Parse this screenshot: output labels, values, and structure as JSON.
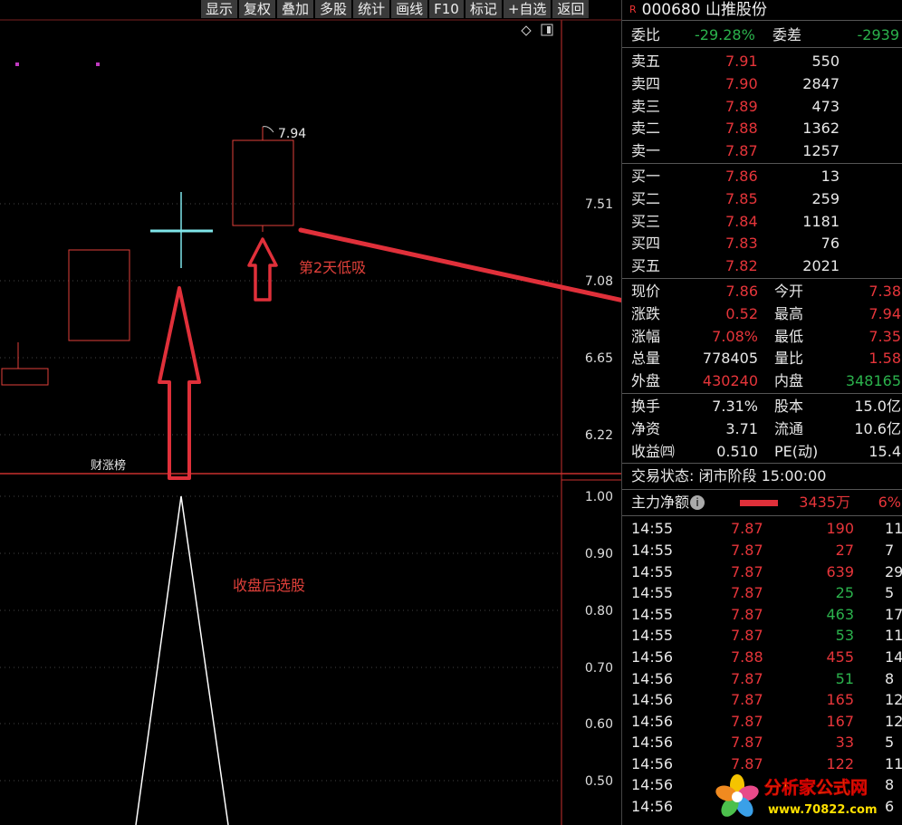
{
  "toolbar": [
    "显示",
    "复权",
    "叠加",
    "多股",
    "统计",
    "画线",
    "F10",
    "标记",
    "+自选",
    "返回"
  ],
  "chart": {
    "price_axis": [
      "7.51",
      "7.08",
      "6.65",
      "6.22"
    ],
    "indicator_axis": [
      "1.00",
      "0.90",
      "0.80",
      "0.70",
      "0.60",
      "0.50"
    ],
    "high_label": "7.94",
    "annotation_day2": "第2天低吸",
    "annotation_select": "收盘后选股",
    "badge": "财涨榜"
  },
  "panel": {
    "stock_code": "000680",
    "stock_name": "山推股份",
    "mark": "R",
    "weibi": {
      "label1": "委比",
      "val1": "-29.28%",
      "label2": "委差",
      "val2": "-2939"
    },
    "sell": [
      {
        "label": "卖五",
        "price": "7.91",
        "vol": "550"
      },
      {
        "label": "卖四",
        "price": "7.90",
        "vol": "2847"
      },
      {
        "label": "卖三",
        "price": "7.89",
        "vol": "473"
      },
      {
        "label": "卖二",
        "price": "7.88",
        "vol": "1362"
      },
      {
        "label": "卖一",
        "price": "7.87",
        "vol": "1257"
      }
    ],
    "buy": [
      {
        "label": "买一",
        "price": "7.86",
        "vol": "13"
      },
      {
        "label": "买二",
        "price": "7.85",
        "vol": "259"
      },
      {
        "label": "买三",
        "price": "7.84",
        "vol": "1181"
      },
      {
        "label": "买四",
        "price": "7.83",
        "vol": "76"
      },
      {
        "label": "买五",
        "price": "7.82",
        "vol": "2021"
      }
    ],
    "quote": [
      {
        "l1": "现价",
        "v1": "7.86",
        "l2": "今开",
        "v2": "7.38"
      },
      {
        "l1": "涨跌",
        "v1": "0.52",
        "l2": "最高",
        "v2": "7.94"
      },
      {
        "l1": "涨幅",
        "v1": "7.08%",
        "l2": "最低",
        "v2": "7.35"
      },
      {
        "l1": "总量",
        "v1": "778405",
        "l2": "量比",
        "v2": "1.58"
      },
      {
        "l1": "外盘",
        "v1": "430240",
        "l2": "内盘",
        "v2": "348165"
      }
    ],
    "stats": [
      {
        "l1": "换手",
        "v1": "7.31%",
        "l2": "股本",
        "v2": "15.0亿"
      },
      {
        "l1": "净资",
        "v1": "3.71",
        "l2": "流通",
        "v2": "10.6亿"
      },
      {
        "l1": "收益㈣",
        "v1": "0.510",
        "l2": "PE(动)",
        "v2": "15.4"
      }
    ],
    "trade_status": "交易状态: 闭市阶段 15:00:00",
    "main_force": {
      "label": "主力净额",
      "value": "3435万",
      "pct": "6%"
    },
    "ticks": [
      {
        "t": "14:55",
        "p": "7.87",
        "v": "190",
        "n": "11",
        "c": "red"
      },
      {
        "t": "14:55",
        "p": "7.87",
        "v": "27",
        "n": "7",
        "c": "red"
      },
      {
        "t": "14:55",
        "p": "7.87",
        "v": "639",
        "n": "29",
        "c": "red"
      },
      {
        "t": "14:55",
        "p": "7.87",
        "v": "25",
        "n": "5",
        "c": "green"
      },
      {
        "t": "14:55",
        "p": "7.87",
        "v": "463",
        "n": "17",
        "c": "green"
      },
      {
        "t": "14:55",
        "p": "7.87",
        "v": "53",
        "n": "11",
        "c": "green"
      },
      {
        "t": "14:56",
        "p": "7.88",
        "v": "455",
        "n": "14",
        "c": "red"
      },
      {
        "t": "14:56",
        "p": "7.87",
        "v": "51",
        "n": "8",
        "c": "green"
      },
      {
        "t": "14:56",
        "p": "7.87",
        "v": "165",
        "n": "12",
        "c": "red"
      },
      {
        "t": "14:56",
        "p": "7.87",
        "v": "167",
        "n": "12",
        "c": "red"
      },
      {
        "t": "14:56",
        "p": "7.87",
        "v": "33",
        "n": "5",
        "c": "red"
      },
      {
        "t": "14:56",
        "p": "7.87",
        "v": "122",
        "n": "11",
        "c": "red"
      },
      {
        "t": "14:56",
        "p": "",
        "v": "",
        "n": "8",
        "c": "red"
      },
      {
        "t": "14:56",
        "p": "",
        "v": "",
        "n": "6",
        "c": "red"
      }
    ]
  },
  "watermark": {
    "text": "分析家公式网",
    "url": "www.70822.com"
  }
}
